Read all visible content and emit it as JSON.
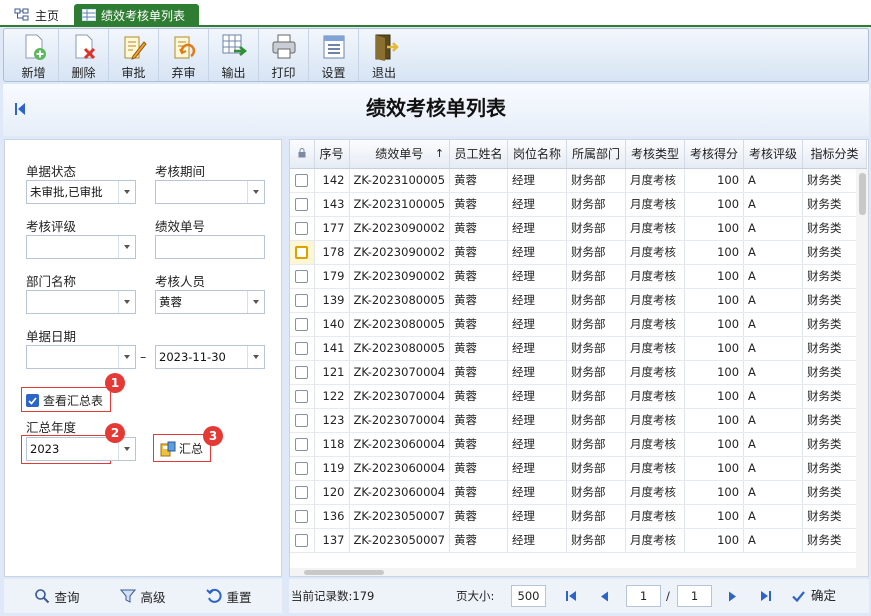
{
  "tabs": {
    "home": "主页",
    "active": "绩效考核单列表"
  },
  "toolbar": {
    "new": "新增",
    "delete": "删除",
    "approve": "审批",
    "unapprove": "弃审",
    "export": "输出",
    "print": "打印",
    "settings": "设置",
    "exit": "退出"
  },
  "page_title": "绩效考核单列表",
  "filters": {
    "status_label": "单据状态",
    "status_value": "未审批,已审批",
    "period_label": "考核期间",
    "period_value": "",
    "rating_label": "考核评级",
    "rating_value": "",
    "doc_no_label": "绩效单号",
    "doc_no_value": "",
    "dept_label": "部门名称",
    "dept_value": "",
    "person_label": "考核人员",
    "person_value": "黄蓉",
    "date_label": "单据日期",
    "date_from": "",
    "date_sep": "–",
    "date_to": "2023-11-30",
    "summary_check_label": "查看汇总表",
    "year_label": "汇总年度",
    "year_value": "2023",
    "summary_button": "汇总"
  },
  "badges": [
    "1",
    "2",
    "3"
  ],
  "bottom_buttons": {
    "query": "查询",
    "advanced": "高级",
    "reset": "重置"
  },
  "table": {
    "columns": [
      "序号",
      "绩效单号",
      "员工姓名",
      "岗位名称",
      "所属部门",
      "考核类型",
      "考核得分",
      "考核评级",
      "指标分类"
    ],
    "sort_indicator": "↑",
    "rows": [
      [
        "142",
        "ZK-2023100005",
        "黄蓉",
        "经理",
        "财务部",
        "月度考核",
        "100",
        "A",
        "财务类"
      ],
      [
        "143",
        "ZK-2023100005",
        "黄蓉",
        "经理",
        "财务部",
        "月度考核",
        "100",
        "A",
        "财务类"
      ],
      [
        "177",
        "ZK-2023090002",
        "黄蓉",
        "经理",
        "财务部",
        "月度考核",
        "100",
        "A",
        "财务类"
      ],
      [
        "178",
        "ZK-2023090002",
        "黄蓉",
        "经理",
        "财务部",
        "月度考核",
        "100",
        "A",
        "财务类"
      ],
      [
        "179",
        "ZK-2023090002",
        "黄蓉",
        "经理",
        "财务部",
        "月度考核",
        "100",
        "A",
        "财务类"
      ],
      [
        "139",
        "ZK-2023080005",
        "黄蓉",
        "经理",
        "财务部",
        "月度考核",
        "100",
        "A",
        "财务类"
      ],
      [
        "140",
        "ZK-2023080005",
        "黄蓉",
        "经理",
        "财务部",
        "月度考核",
        "100",
        "A",
        "财务类"
      ],
      [
        "141",
        "ZK-2023080005",
        "黄蓉",
        "经理",
        "财务部",
        "月度考核",
        "100",
        "A",
        "财务类"
      ],
      [
        "121",
        "ZK-2023070004",
        "黄蓉",
        "经理",
        "财务部",
        "月度考核",
        "100",
        "A",
        "财务类"
      ],
      [
        "122",
        "ZK-2023070004",
        "黄蓉",
        "经理",
        "财务部",
        "月度考核",
        "100",
        "A",
        "财务类"
      ],
      [
        "123",
        "ZK-2023070004",
        "黄蓉",
        "经理",
        "财务部",
        "月度考核",
        "100",
        "A",
        "财务类"
      ],
      [
        "118",
        "ZK-2023060004",
        "黄蓉",
        "经理",
        "财务部",
        "月度考核",
        "100",
        "A",
        "财务类"
      ],
      [
        "119",
        "ZK-2023060004",
        "黄蓉",
        "经理",
        "财务部",
        "月度考核",
        "100",
        "A",
        "财务类"
      ],
      [
        "120",
        "ZK-2023060004",
        "黄蓉",
        "经理",
        "财务部",
        "月度考核",
        "100",
        "A",
        "财务类"
      ],
      [
        "136",
        "ZK-2023050007",
        "黄蓉",
        "经理",
        "财务部",
        "月度考核",
        "100",
        "A",
        "财务类"
      ],
      [
        "137",
        "ZK-2023050007",
        "黄蓉",
        "经理",
        "财务部",
        "月度考核",
        "100",
        "A",
        "财务类"
      ]
    ]
  },
  "pager": {
    "record_label": "当前记录数:179",
    "page_size_label": "页大小:",
    "page_size": "500",
    "page": "1",
    "sep": "/",
    "total_pages": "1",
    "confirm": "确定"
  }
}
